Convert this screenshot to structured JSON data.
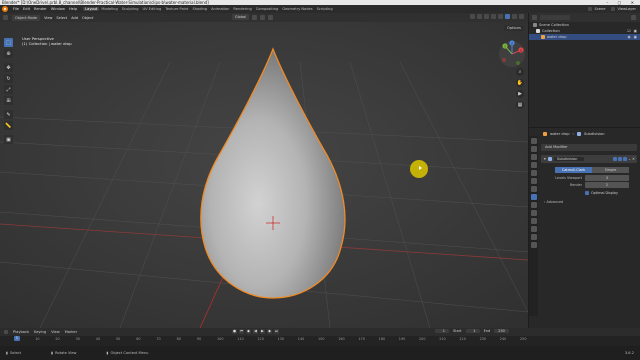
{
  "titlebar": {
    "title": "Blender* [D:\\OneDrive\\.prbl.8_channel\\Blender-Practical-Water-Simulation\\clips-b\\water-material.blend]"
  },
  "menubar": {
    "file": "File",
    "edit": "Edit",
    "render": "Render",
    "window": "Window",
    "help": "Help",
    "workspaces": [
      "Layout",
      "Modeling",
      "Sculpting",
      "UV Editing",
      "Texture Paint",
      "Shading",
      "Animation",
      "Rendering",
      "Compositing",
      "Geometry Nodes",
      "Scripting"
    ],
    "active_workspace": "Layout",
    "scene_label": "Scene",
    "view_layer_label": "ViewLayer"
  },
  "viewport_header": {
    "mode": "Object Mode",
    "view": "View",
    "select": "Select",
    "add": "Add",
    "object": "Object",
    "orientation": "Global",
    "options": "Options"
  },
  "viewport": {
    "perspective": "User Perspective",
    "collection_info": "(1) Collection | water drop",
    "gizmo_x": "X",
    "gizmo_y": "Y",
    "gizmo_z": "Z"
  },
  "outliner": {
    "items": [
      {
        "label": "Scene Collection"
      },
      {
        "label": "Collection"
      },
      {
        "label": "water drop"
      }
    ]
  },
  "properties": {
    "object_name": "water drop",
    "modifier_breadcrumb": "Subdivision",
    "add_modifier": "Add Modifier",
    "modifier_name": "Subdivision",
    "mode_catmull": "Catmull-Clark",
    "mode_simple": "Simple",
    "levels_viewport_label": "Levels Viewport",
    "levels_viewport_value": "3",
    "render_label": "Render",
    "render_value": "2",
    "optimal_display": "Optimal Display",
    "advanced": "Advanced"
  },
  "timeline": {
    "playback": "Playback",
    "keying": "Keying",
    "view": "View",
    "marker": "Marker",
    "current_frame": "1",
    "start_label": "Start",
    "start_value": "1",
    "end_label": "End",
    "end_value": "250",
    "ruler_ticks": [
      "0",
      "10",
      "20",
      "30",
      "40",
      "50",
      "60",
      "70",
      "80",
      "90",
      "100",
      "110",
      "120",
      "130",
      "140",
      "150",
      "160",
      "170",
      "180",
      "190",
      "200",
      "210",
      "220",
      "230",
      "240",
      "250"
    ]
  },
  "statusbar": {
    "select": "Select",
    "rotate_view": "Rotate View",
    "context_menu": "Object Context Menu",
    "version": "3.6.2"
  },
  "colors": {
    "accent": "#4772b3",
    "selection_outline": "#f08a24",
    "cursor_highlight": "#d2be00"
  }
}
